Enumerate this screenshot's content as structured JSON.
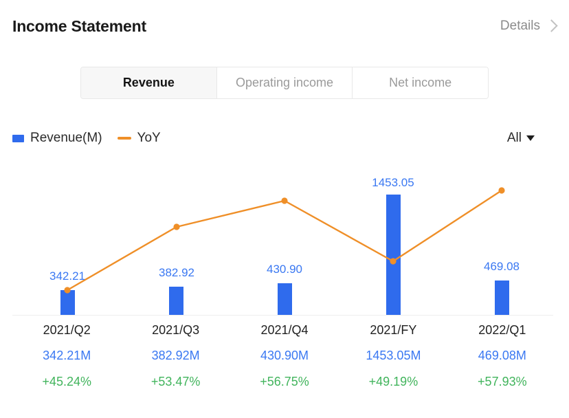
{
  "header": {
    "title": "Income Statement",
    "details_label": "Details",
    "chevron_icon": "chevron-right-icon"
  },
  "tabs": [
    {
      "label": "Revenue",
      "active": true
    },
    {
      "label": "Operating income",
      "active": false
    },
    {
      "label": "Net income",
      "active": false
    }
  ],
  "legend": {
    "items": [
      {
        "label": "Revenue(M)",
        "type": "bar",
        "color": "#2f6bed"
      },
      {
        "label": "YoY",
        "type": "line",
        "color": "#ef8f28"
      }
    ],
    "range_selector": {
      "value": "All",
      "caret_icon": "caret-down-icon"
    }
  },
  "colors": {
    "bar": "#2f6bed",
    "line": "#ef8f28",
    "value_text": "#3a78f2",
    "positive_change": "#41b45c",
    "period_text": "#1f1f1f",
    "muted": "#8b8b8b"
  },
  "chart_data": {
    "type": "bar",
    "title": "Income Statement",
    "xlabel": "",
    "ylabel": "",
    "grid": false,
    "legend_position": "top-left",
    "categories": [
      "2021/Q2",
      "2021/Q3",
      "2021/Q4",
      "2021/FY",
      "2022/Q1"
    ],
    "series": [
      {
        "name": "Revenue(M)",
        "type": "bar",
        "color": "#2f6bed",
        "values": [
          342.21,
          382.92,
          430.9,
          1453.05,
          469.08
        ],
        "labels": [
          "342.21",
          "382.92",
          "430.90",
          "1453.05",
          "469.08"
        ]
      },
      {
        "name": "YoY",
        "type": "line",
        "color": "#ef8f28",
        "values": [
          45.24,
          53.47,
          56.75,
          49.19,
          57.93
        ],
        "labels": [
          "+45.24%",
          "+53.47%",
          "+56.75%",
          "+49.19%",
          "+57.93%"
        ]
      }
    ],
    "ylim": [
      0,
      1453.05
    ],
    "y2lim": [
      45.24,
      57.93
    ]
  },
  "table": {
    "rows": [
      {
        "period": "2021/Q2",
        "value": "342.21M",
        "change": "+45.24%"
      },
      {
        "period": "2021/Q3",
        "value": "382.92M",
        "change": "+53.47%"
      },
      {
        "period": "2021/Q4",
        "value": "430.90M",
        "change": "+56.75%"
      },
      {
        "period": "2021/FY",
        "value": "1453.05M",
        "change": "+49.19%"
      },
      {
        "period": "2022/Q1",
        "value": "469.08M",
        "change": "+57.93%"
      }
    ]
  }
}
